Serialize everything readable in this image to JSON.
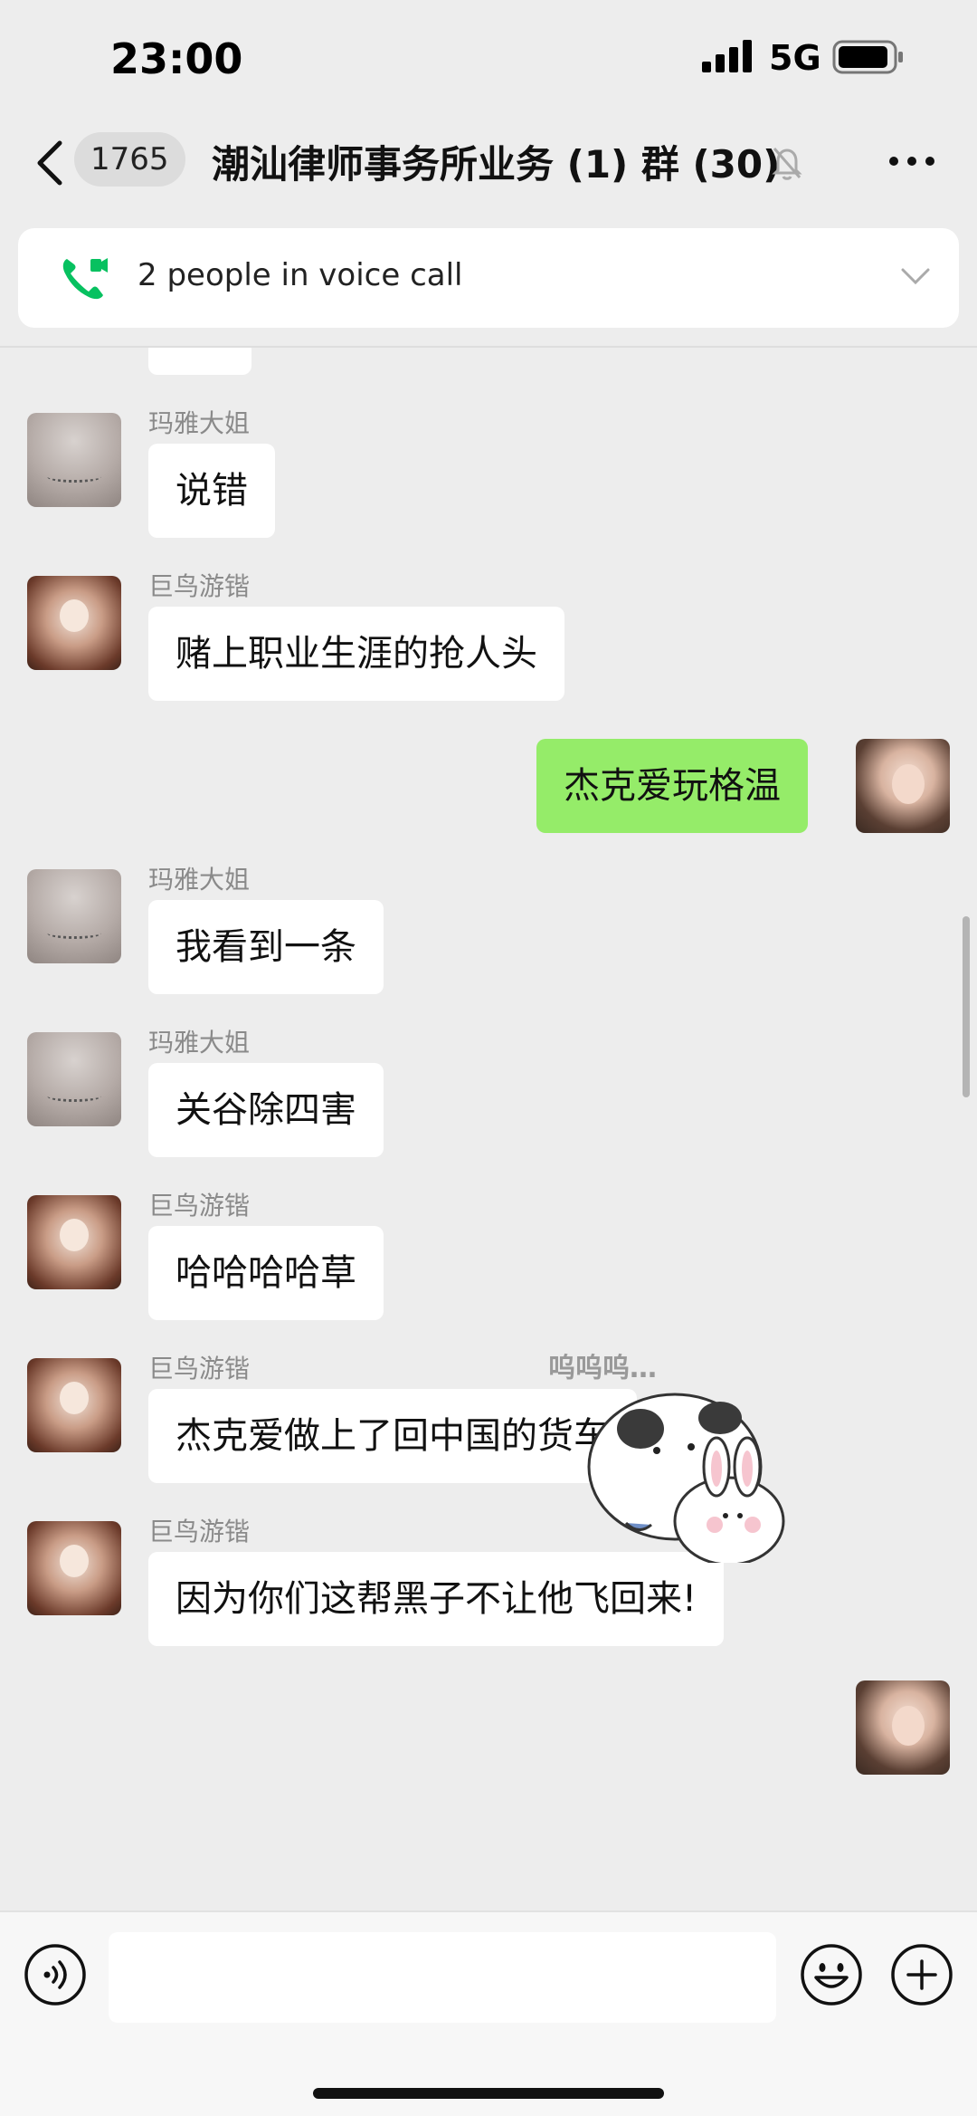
{
  "status_bar": {
    "time": "23:00",
    "network": "5G",
    "signal_icon": "signal-bars-icon",
    "battery_icon": "battery-icon"
  },
  "header": {
    "back_icon": "chevron-left-icon",
    "unread_count": "1765",
    "title": "潮汕律师事务所业务 (1) 群 (30)",
    "mute_icon": "bell-slash-icon",
    "more_icon": "ellipsis-icon"
  },
  "voice_call": {
    "text": "2 people in voice call",
    "icon": "phone-call-icon",
    "accent": "#07c160"
  },
  "messages": [
    {
      "sender": "玛雅大姐",
      "text": "说错"
    },
    {
      "sender": "巨鸟游锴",
      "text": "赌上职业生涯的抢人头"
    },
    {
      "sender": "me",
      "text": "杰克爱玩格温"
    },
    {
      "sender": "玛雅大姐",
      "text": "我看到一条"
    },
    {
      "sender": "玛雅大姐",
      "text": "关谷除四害"
    },
    {
      "sender": "巨鸟游锴",
      "text": "哈哈哈哈草"
    },
    {
      "sender": "巨鸟游锴",
      "text": "杰克爱做上了回中国的货车"
    },
    {
      "sender": "巨鸟游锴",
      "text": "因为你们这帮黑子不让他飞回来!"
    },
    {
      "sender": "me",
      "sticker_text": "呜呜呜…"
    }
  ],
  "colors": {
    "background": "#ededed",
    "my_bubble": "#95ec69",
    "other_bubble": "#ffffff"
  },
  "input_bar": {
    "value": "",
    "voice_icon": "voice-input-icon",
    "emoji_icon": "emoji-icon",
    "plus_icon": "plus-icon"
  }
}
